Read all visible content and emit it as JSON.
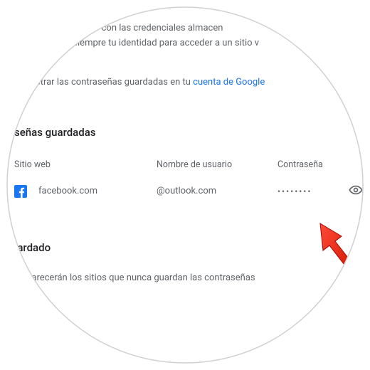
{
  "intro": {
    "line1": "a los sitios web con las credenciales almacen",
    "line2": "onfirmar siempre tu identidad para acceder a un sitio v"
  },
  "manage": {
    "prefix": "strar las contraseñas guardadas en tu ",
    "link": "cuenta de Google"
  },
  "saved": {
    "title": "señas guardadas",
    "col_site": "Sitio web",
    "col_user": "Nombre de usuario",
    "col_pass": "Contraseña",
    "rows": [
      {
        "site": "facebook.com",
        "user": "@outlook.com",
        "pass": "••••••••"
      }
    ]
  },
  "never": {
    "title": "uardado",
    "hint": "aparecerán los sitios que nunca guardan las contraseñas"
  }
}
